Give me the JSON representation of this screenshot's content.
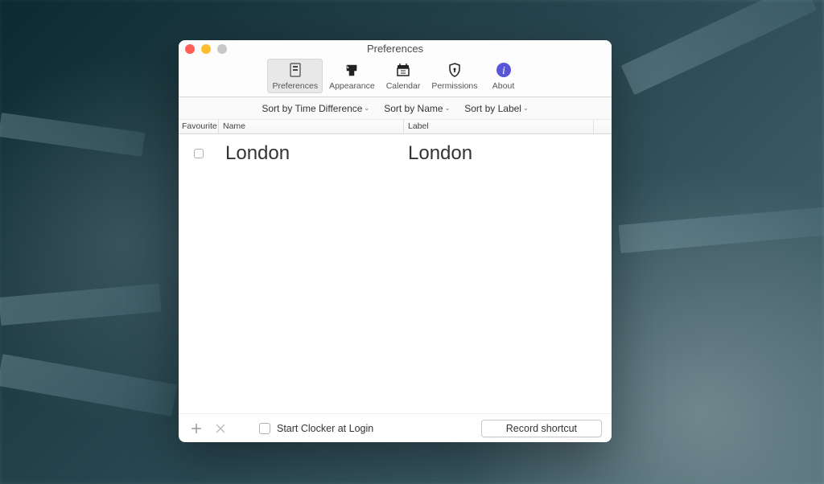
{
  "window": {
    "title": "Preferences"
  },
  "toolbar": {
    "items": [
      {
        "label": "Preferences",
        "icon": "preferences"
      },
      {
        "label": "Appearance",
        "icon": "appearance"
      },
      {
        "label": "Calendar",
        "icon": "calendar"
      },
      {
        "label": "Permissions",
        "icon": "permissions"
      },
      {
        "label": "About",
        "icon": "about"
      }
    ],
    "active_index": 0
  },
  "sortbar": {
    "options": [
      "Sort by Time Difference",
      "Sort by Name",
      "Sort by Label"
    ]
  },
  "table": {
    "headers": {
      "favourite": "Favourite",
      "name": "Name",
      "label": "Label"
    },
    "rows": [
      {
        "favourite": false,
        "name": "London",
        "label": "London"
      }
    ]
  },
  "bottombar": {
    "start_at_login_label": "Start Clocker at Login",
    "start_at_login_checked": false,
    "record_shortcut_label": "Record shortcut"
  }
}
